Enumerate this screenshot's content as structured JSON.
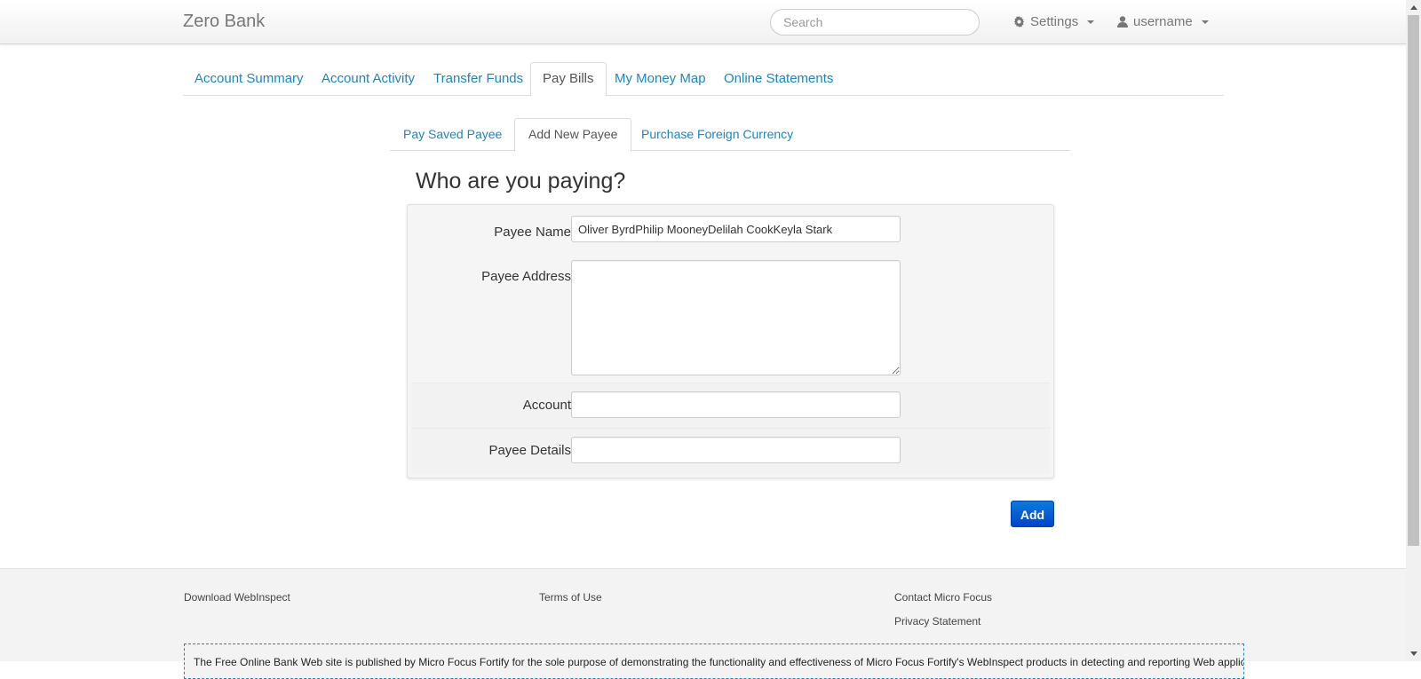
{
  "header": {
    "brand": "Zero Bank",
    "search_placeholder": "Search",
    "settings_label": "Settings",
    "user_label": "username"
  },
  "main_tabs": [
    {
      "label": "Account Summary",
      "active": false
    },
    {
      "label": "Account Activity",
      "active": false
    },
    {
      "label": "Transfer Funds",
      "active": false
    },
    {
      "label": "Pay Bills",
      "active": true
    },
    {
      "label": "My Money Map",
      "active": false
    },
    {
      "label": "Online Statements",
      "active": false
    }
  ],
  "sub_tabs": [
    {
      "label": "Pay Saved Payee",
      "active": false
    },
    {
      "label": "Add New Payee",
      "active": true
    },
    {
      "label": "Purchase Foreign Currency",
      "active": false
    }
  ],
  "form": {
    "title": "Who are you paying?",
    "payee_name_label": "Payee Name",
    "payee_name_value": "Oliver ByrdPhilip MooneyDelilah CookKeyla Stark",
    "payee_address_label": "Payee Address",
    "payee_address_value": "",
    "account_label": "Account",
    "account_value": "",
    "payee_details_label": "Payee Details",
    "payee_details_value": "",
    "add_button": "Add"
  },
  "footer": {
    "download": "Download WebInspect",
    "terms": "Terms of Use",
    "contact": "Contact Micro Focus",
    "privacy": "Privacy Statement",
    "disclaimer": "The Free Online Bank Web site is published by Micro Focus Fortify for the sole purpose of demonstrating the functionality and effectiveness of Micro Focus Fortify's WebInspect products in detecting and reporting Web application"
  },
  "colors": {
    "link": "#1a86c8",
    "button_primary": "#0055cc"
  }
}
